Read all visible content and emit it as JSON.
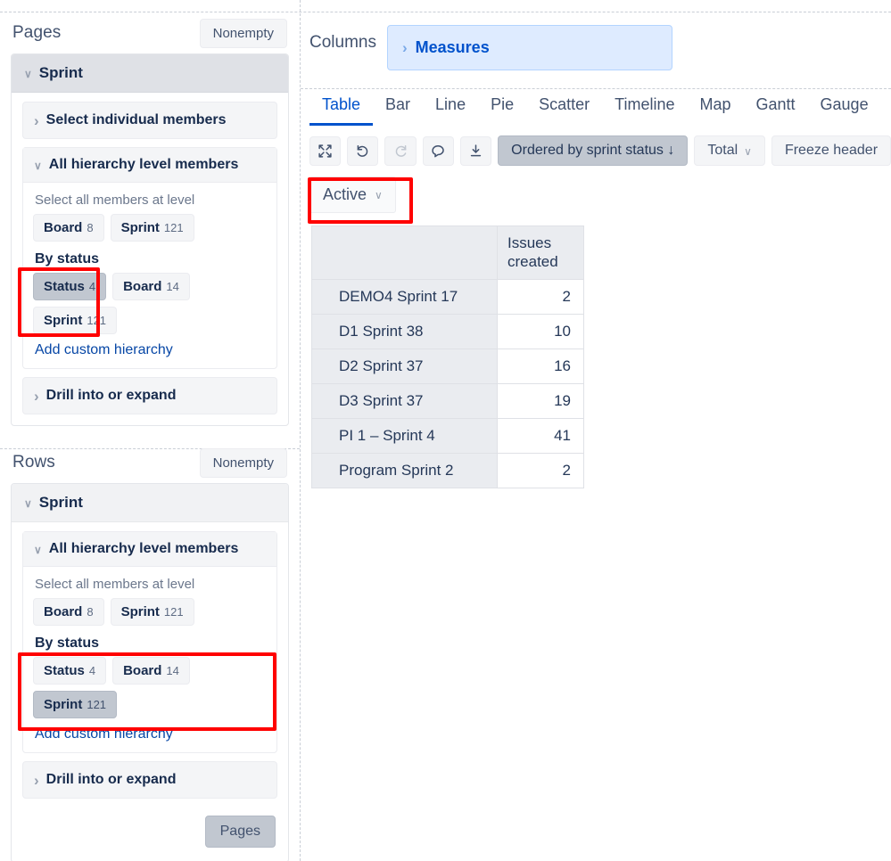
{
  "shelves": [
    {
      "title": "Pages",
      "nonempty_label": "Nonempty",
      "dimension": "Sprint",
      "panels": {
        "select_individual": "Select individual members",
        "all_hierarchy": "All hierarchy level members",
        "select_all_label": "Select all members at level",
        "level_chips": [
          {
            "label": "Board",
            "count": "8",
            "selected": false
          },
          {
            "label": "Sprint",
            "count": "121",
            "selected": false
          }
        ],
        "by_status_label": "By status",
        "status_chips": [
          {
            "label": "Status",
            "count": "4",
            "selected": true
          },
          {
            "label": "Board",
            "count": "14",
            "selected": false
          },
          {
            "label": "Sprint",
            "count": "121",
            "selected": false
          }
        ],
        "add_custom": "Add custom hierarchy",
        "drill": "Drill into or expand"
      }
    },
    {
      "title": "Rows",
      "nonempty_label": "Nonempty",
      "dimension": "Sprint",
      "panels": {
        "all_hierarchy": "All hierarchy level members",
        "select_all_label": "Select all members at level",
        "level_chips": [
          {
            "label": "Board",
            "count": "8",
            "selected": false
          },
          {
            "label": "Sprint",
            "count": "121",
            "selected": false
          }
        ],
        "by_status_label": "By status",
        "status_chips": [
          {
            "label": "Status",
            "count": "4",
            "selected": false
          },
          {
            "label": "Board",
            "count": "14",
            "selected": false
          },
          {
            "label": "Sprint",
            "count": "121",
            "selected": true
          }
        ],
        "add_custom": "Add custom hierarchy",
        "drill": "Drill into or expand"
      },
      "footer_button": "Pages"
    }
  ],
  "columns": {
    "title": "Columns",
    "pill_label": "Measures"
  },
  "viz_tabs": [
    {
      "label": "Table",
      "active": true
    },
    {
      "label": "Bar",
      "active": false
    },
    {
      "label": "Line",
      "active": false
    },
    {
      "label": "Pie",
      "active": false
    },
    {
      "label": "Scatter",
      "active": false
    },
    {
      "label": "Timeline",
      "active": false
    },
    {
      "label": "Map",
      "active": false
    },
    {
      "label": "Gantt",
      "active": false
    },
    {
      "label": "Gauge",
      "active": false
    }
  ],
  "toolbar": {
    "icons": [
      {
        "name": "fullscreen-icon",
        "glyph": "⤡",
        "disabled": false
      },
      {
        "name": "undo-icon",
        "glyph": "↺",
        "disabled": false
      },
      {
        "name": "redo-icon",
        "glyph": "↻",
        "disabled": true
      },
      {
        "name": "comment-icon",
        "glyph": "○",
        "disabled": false
      },
      {
        "name": "download-icon",
        "glyph": "↓",
        "disabled": false
      }
    ],
    "order_button": "Ordered by sprint status ↓",
    "total_button": "Total",
    "freeze_button": "Freeze header"
  },
  "page_filter": {
    "value": "Active"
  },
  "chart_data": {
    "type": "table",
    "title": "",
    "columns": [
      "",
      "Issues created"
    ],
    "rows": [
      {
        "label": "DEMO4 Sprint 17",
        "value": "2"
      },
      {
        "label": "D1 Sprint 38",
        "value": "10"
      },
      {
        "label": "D2 Sprint 37",
        "value": "16"
      },
      {
        "label": "D3 Sprint 37",
        "value": "19"
      },
      {
        "label": "PI 1 – Sprint 4",
        "value": "41"
      },
      {
        "label": "Program Sprint 2",
        "value": "2"
      }
    ],
    "categories": [
      "DEMO4 Sprint 17",
      "D1 Sprint 38",
      "D2 Sprint 37",
      "D3 Sprint 37",
      "PI 1 – Sprint 4",
      "Program Sprint 2"
    ],
    "values": [
      2,
      10,
      16,
      19,
      41,
      2
    ],
    "ylabel": "Issues created"
  },
  "colors": {
    "accent_blue": "#0052cc",
    "link_blue": "#0747a6",
    "pill_bg": "#deebff",
    "selected_chip": "#c1c7d0",
    "annotation_red": "#ff0000",
    "text": "#253858"
  }
}
